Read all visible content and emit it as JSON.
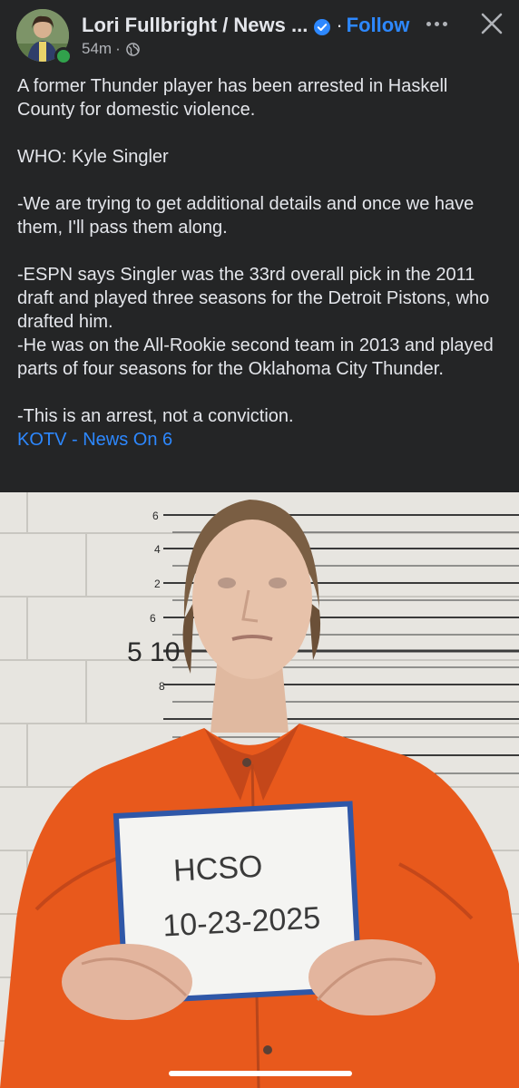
{
  "header": {
    "author_name": "Lori Fullbright / News ...",
    "separator": "·",
    "follow_label": "Follow",
    "timestamp": "54m",
    "meta_separator": "·",
    "icons": [
      "verified-badge-icon",
      "globe-icon",
      "more-options-icon",
      "close-icon"
    ]
  },
  "post": {
    "lines": [
      "A former Thunder player has been arrested in Haskell County for domestic violence.",
      "WHO: Kyle Singler",
      "-We are trying to get additional details and once we have them, I'll pass them along.",
      "-ESPN says Singler was the 33rd overall pick in the 2011 draft and played three seasons for the Detroit Pistons, who drafted him.",
      "-He was on the All-Rookie second team in 2013 and played parts of four seasons for the Oklahoma City Thunder.",
      "-This is an arrest, not a conviction."
    ],
    "link_text": "KOTV - News On 6"
  },
  "photo": {
    "height_marks": [
      "6",
      "4",
      "2",
      "6",
      "5 10",
      "8"
    ],
    "sign_line1": "HCSO",
    "sign_line2": "10-23-2025"
  },
  "colors": {
    "background": "#242526",
    "text": "#e4e6eb",
    "secondary_text": "#b0b3b8",
    "link": "#2d88ff",
    "online": "#31a24c",
    "jumpsuit": "#e8591c"
  }
}
